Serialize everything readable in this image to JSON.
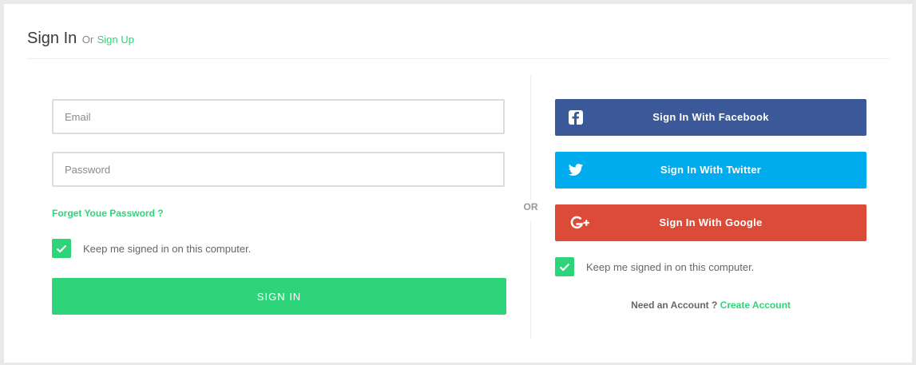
{
  "header": {
    "title": "Sign In",
    "or_text": "Or",
    "signup_link": "Sign Up"
  },
  "form": {
    "email_placeholder": "Email",
    "password_placeholder": "Password",
    "forgot_link": "Forget Youe Password ?",
    "keep_signed_in": "Keep me signed in on this computer.",
    "keep_signed_in_checked": true,
    "signin_button": "SIGN IN"
  },
  "divider": {
    "or_text": "OR"
  },
  "social": {
    "facebook": {
      "label": "Sign In With Facebook",
      "icon": "facebook-icon",
      "color": "#3b5998"
    },
    "twitter": {
      "label": "Sign In With Twitter",
      "icon": "twitter-icon",
      "color": "#00acee"
    },
    "google": {
      "label": "Sign In With Google",
      "icon": "google-plus-icon",
      "color": "#dc4a38"
    },
    "keep_signed_in": "Keep me signed in on this computer.",
    "keep_signed_in_checked": true,
    "need_account": "Need an Account ?",
    "create_account": "Create Account"
  },
  "colors": {
    "accent": "#2ed47a",
    "background": "#e9e9ec"
  }
}
